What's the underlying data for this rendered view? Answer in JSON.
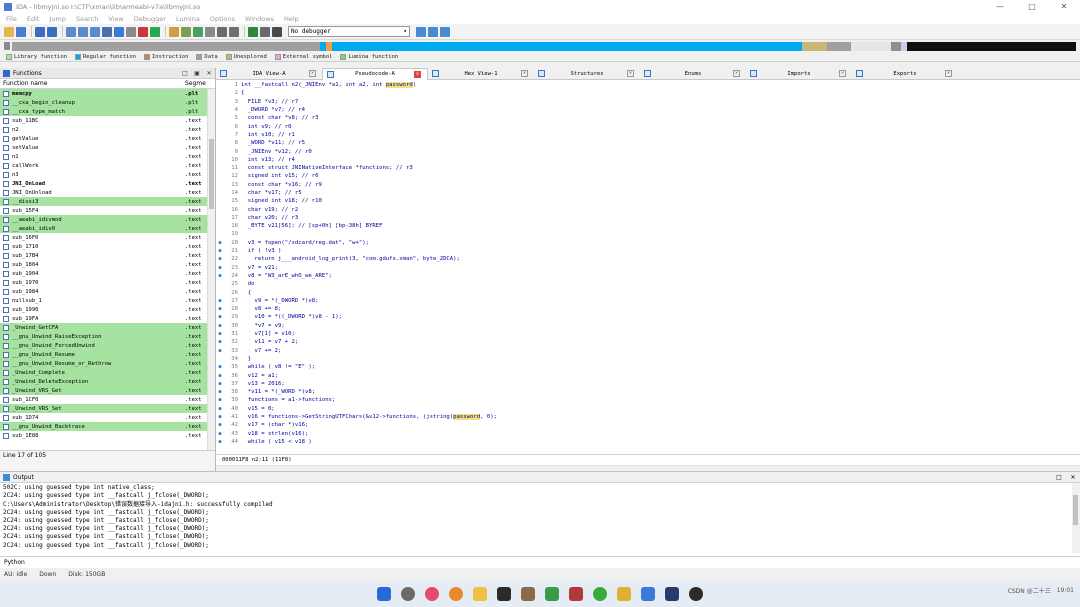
{
  "window": {
    "title": "IDA - libmyjni.so I:\\CTF\\xman\\lib\\armeabi-v7a\\libmyjni.so",
    "minimize": "—",
    "maximize": "□",
    "close": "✕"
  },
  "menu": [
    "File",
    "Edit",
    "Jump",
    "Search",
    "View",
    "Debugger",
    "Lumina",
    "Options",
    "Windows",
    "Help"
  ],
  "toolbar": {
    "debugger_select": "No debugger"
  },
  "legend": [
    "Library function",
    "Regular function",
    "Instruction",
    "Data",
    "Unexplored",
    "External symbol",
    "Lumina function"
  ],
  "functions_panel": {
    "title": "Functions",
    "col_name": "Function name",
    "col_segment": "Segme",
    "status": "Line 17 of 105",
    "rows": [
      {
        "name": "memcpy",
        "seg": ".plt",
        "lib": true,
        "bold": true
      },
      {
        "name": "__cxa_begin_cleanup",
        "seg": ".plt",
        "lib": true,
        "bold": false
      },
      {
        "name": "__cxa_type_match",
        "seg": ".plt",
        "lib": true,
        "bold": false
      },
      {
        "name": "sub_11BC",
        "seg": ".text",
        "lib": false,
        "bold": false
      },
      {
        "name": "n2",
        "seg": ".text",
        "lib": false,
        "bold": false
      },
      {
        "name": "getValue",
        "seg": ".text",
        "lib": false,
        "bold": false
      },
      {
        "name": "setValue",
        "seg": ".text",
        "lib": false,
        "bold": false
      },
      {
        "name": "n1",
        "seg": ".text",
        "lib": false,
        "bold": false
      },
      {
        "name": "callWork",
        "seg": ".text",
        "lib": false,
        "bold": false
      },
      {
        "name": "n3",
        "seg": ".text",
        "lib": false,
        "bold": false
      },
      {
        "name": "JNI_OnLoad",
        "seg": ".text",
        "lib": false,
        "bold": true
      },
      {
        "name": "JNI_OnUnload",
        "seg": ".text",
        "lib": false,
        "bold": false
      },
      {
        "name": "__divsi3",
        "seg": ".text",
        "lib": true,
        "bold": false
      },
      {
        "name": "sub_15F4",
        "seg": ".text",
        "lib": false,
        "bold": false
      },
      {
        "name": "__aeabi_idivmod",
        "seg": ".text",
        "lib": true,
        "bold": false
      },
      {
        "name": "__aeabi_idiv0",
        "seg": ".text",
        "lib": true,
        "bold": false
      },
      {
        "name": "sub_16F0",
        "seg": ".text",
        "lib": false,
        "bold": false
      },
      {
        "name": "sub_1710",
        "seg": ".text",
        "lib": false,
        "bold": false
      },
      {
        "name": "sub_17B4",
        "seg": ".text",
        "lib": false,
        "bold": false
      },
      {
        "name": "sub_1804",
        "seg": ".text",
        "lib": false,
        "bold": false
      },
      {
        "name": "sub_1904",
        "seg": ".text",
        "lib": false,
        "bold": false
      },
      {
        "name": "sub_1970",
        "seg": ".text",
        "lib": false,
        "bold": false
      },
      {
        "name": "sub_1984",
        "seg": ".text",
        "lib": false,
        "bold": false
      },
      {
        "name": "nullsub_1",
        "seg": ".text",
        "lib": false,
        "bold": false
      },
      {
        "name": "sub_1990",
        "seg": ".text",
        "lib": false,
        "bold": false
      },
      {
        "name": "sub_19FA",
        "seg": ".text",
        "lib": false,
        "bold": false
      },
      {
        "name": "_Unwind_GetCFA",
        "seg": ".text",
        "lib": true,
        "bold": false
      },
      {
        "name": "__gnu_Unwind_RaiseException",
        "seg": ".text",
        "lib": true,
        "bold": false
      },
      {
        "name": "__gnu_Unwind_ForcedUnwind",
        "seg": ".text",
        "lib": true,
        "bold": false
      },
      {
        "name": "__gnu_Unwind_Resume",
        "seg": ".text",
        "lib": true,
        "bold": false
      },
      {
        "name": "__gnu_Unwind_Resume_or_Rethrow",
        "seg": ".text",
        "lib": true,
        "bold": false
      },
      {
        "name": "_Unwind_Complete",
        "seg": ".text",
        "lib": true,
        "bold": false
      },
      {
        "name": "_Unwind_DeleteException",
        "seg": ".text",
        "lib": true,
        "bold": false
      },
      {
        "name": "_Unwind_VRS_Get",
        "seg": ".text",
        "lib": true,
        "bold": false
      },
      {
        "name": "sub_1CF0",
        "seg": ".text",
        "lib": false,
        "bold": false
      },
      {
        "name": "_Unwind_VRS_Set",
        "seg": ".text",
        "lib": true,
        "bold": false
      },
      {
        "name": "sub_1D74",
        "seg": ".text",
        "lib": false,
        "bold": false
      },
      {
        "name": "__gnu_Unwind_Backtrace",
        "seg": ".text",
        "lib": true,
        "bold": false
      },
      {
        "name": "sub_1E88",
        "seg": ".text",
        "lib": false,
        "bold": false
      }
    ]
  },
  "tabs": [
    {
      "label": "IDA View-A",
      "active": false
    },
    {
      "label": "Pseudocode-A",
      "active": true
    },
    {
      "label": "Hex View-1",
      "active": false
    },
    {
      "label": "Structures",
      "active": false
    },
    {
      "label": "Enums",
      "active": false
    },
    {
      "label": "Imports",
      "active": false
    },
    {
      "label": "Exports",
      "active": false
    }
  ],
  "code": [
    {
      "n": "1",
      "dot": false,
      "t": "int __fastcall n2(_JNIEnv *a1, int a2, int password)"
    },
    {
      "n": "2",
      "dot": false,
      "t": "{"
    },
    {
      "n": "3",
      "dot": false,
      "t": "  FILE *v3; // r7"
    },
    {
      "n": "4",
      "dot": false,
      "t": "  _DWORD *v7; // r4"
    },
    {
      "n": "5",
      "dot": false,
      "t": "  const char *v8; // r3"
    },
    {
      "n": "6",
      "dot": false,
      "t": "  int v9; // r0"
    },
    {
      "n": "7",
      "dot": false,
      "t": "  int v10; // r1"
    },
    {
      "n": "8",
      "dot": false,
      "t": "  _WORD *v11; // r5"
    },
    {
      "n": "9",
      "dot": false,
      "t": "  _JNIEnv *v12; // r0"
    },
    {
      "n": "10",
      "dot": false,
      "t": "  int v13; // r4"
    },
    {
      "n": "11",
      "dot": false,
      "t": "  const struct JNINativeInterface *functions; // r3"
    },
    {
      "n": "12",
      "dot": false,
      "t": "  signed int v15; // r6"
    },
    {
      "n": "13",
      "dot": false,
      "t": "  const char *v16; // r9"
    },
    {
      "n": "14",
      "dot": false,
      "t": "  char *v17; // r5"
    },
    {
      "n": "15",
      "dot": false,
      "t": "  signed int v18; // r10"
    },
    {
      "n": "16",
      "dot": false,
      "t": "  char v19; // r2"
    },
    {
      "n": "17",
      "dot": false,
      "t": "  char v20; // r3"
    },
    {
      "n": "18",
      "dot": false,
      "t": "  _BYTE v21[56]; // [sp+0h] [bp-38h] BYREF"
    },
    {
      "n": "19",
      "dot": false,
      "t": ""
    },
    {
      "n": "20",
      "dot": true,
      "t": "  v3 = fopen(\"/sdcard/reg.dat\", \"w+\");"
    },
    {
      "n": "21",
      "dot": true,
      "t": "  if ( !v3 )"
    },
    {
      "n": "22",
      "dot": true,
      "t": "    return j___android_log_print(3, \"com.gdufs.xman\", byte_2DCA);"
    },
    {
      "n": "23",
      "dot": true,
      "t": "  v7 = v21;"
    },
    {
      "n": "24",
      "dot": true,
      "t": "  v8 = \"W3_arE_whO_we_ARE\";"
    },
    {
      "n": "25",
      "dot": false,
      "t": "  do"
    },
    {
      "n": "26",
      "dot": false,
      "t": "  {"
    },
    {
      "n": "27",
      "dot": true,
      "t": "    v9 = *(_DWORD *)v8;"
    },
    {
      "n": "28",
      "dot": true,
      "t": "    v8 += 8;"
    },
    {
      "n": "29",
      "dot": true,
      "t": "    v10 = *((_DWORD *)v8 - 1);"
    },
    {
      "n": "30",
      "dot": true,
      "t": "    *v7 = v9;"
    },
    {
      "n": "31",
      "dot": true,
      "t": "    v7[1] = v10;"
    },
    {
      "n": "32",
      "dot": true,
      "t": "    v11 = v7 + 2;"
    },
    {
      "n": "33",
      "dot": true,
      "t": "    v7 += 2;"
    },
    {
      "n": "34",
      "dot": false,
      "t": "  }"
    },
    {
      "n": "35",
      "dot": true,
      "t": "  while ( v8 != \"E\" );"
    },
    {
      "n": "36",
      "dot": true,
      "t": "  v12 = a1;"
    },
    {
      "n": "37",
      "dot": true,
      "t": "  v13 = 2016;"
    },
    {
      "n": "38",
      "dot": true,
      "t": "  *v11 = *(_WORD *)v8;"
    },
    {
      "n": "39",
      "dot": true,
      "t": "  functions = a1->functions;"
    },
    {
      "n": "40",
      "dot": true,
      "t": "  v15 = 0;"
    },
    {
      "n": "41",
      "dot": true,
      "t": "  v16 = functions->GetStringUTFChars(&v12->functions, (jstring)password, 0);"
    },
    {
      "n": "42",
      "dot": true,
      "t": "  v17 = (char *)v16;"
    },
    {
      "n": "43",
      "dot": true,
      "t": "  v18 = strlen(v16);"
    },
    {
      "n": "44",
      "dot": true,
      "t": "  while ( v15 < v18 )"
    }
  ],
  "code_status": "000011F8 n2:11 (11F8)",
  "output": {
    "title": "Output",
    "lines": [
      "502C: using guessed type int native_class;",
      "2C24: using guessed type int __fastcall j_fclose(_DWORD);",
      "C:\\Users\\Administrator\\Desktop\\错误数据接导入-idajni.h: successfully compiled",
      "2C24: using guessed type int __fastcall j_fclose(_DWORD);",
      "2C24: using guessed type int __fastcall j_fclose(_DWORD);",
      "2C24: using guessed type int __fastcall j_fclose(_DWORD);",
      "2C24: using guessed type int __fastcall j_fclose(_DWORD);",
      "2C24: using guessed type int __fastcall j_fclose(_DWORD);"
    ]
  },
  "python_label": "Python",
  "status": {
    "au": "AU:  idle",
    "dir": "Down",
    "disk": "Disk: 150GB"
  },
  "taskbar": {
    "clock": "19:01",
    "tray": "CSDN @二十三"
  },
  "colors": {
    "lib": "#a6e2a0",
    "regular": "#00aaee",
    "unexplored": "#c8b878",
    "accent": "#3467c6"
  }
}
